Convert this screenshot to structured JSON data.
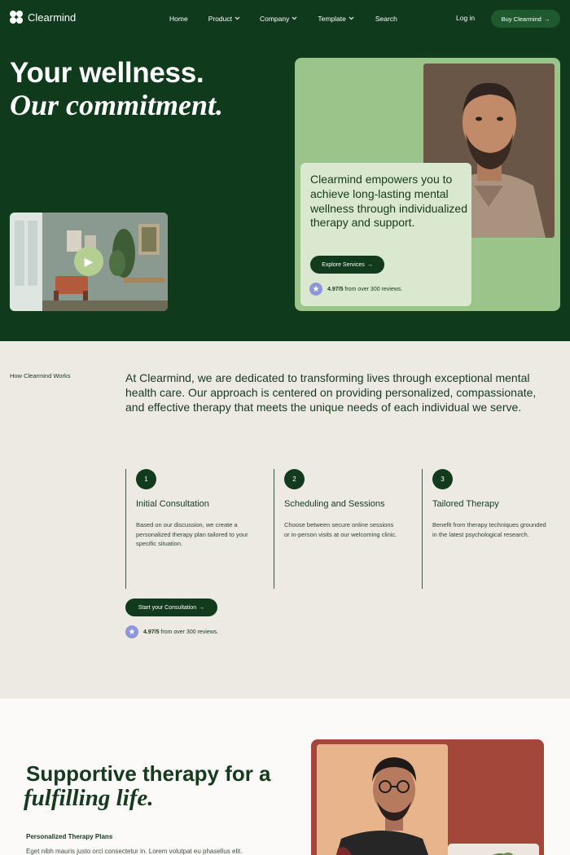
{
  "nav": {
    "brand": "Clearmind",
    "links": [
      {
        "label": "Home",
        "has_dropdown": false
      },
      {
        "label": "Product",
        "has_dropdown": true
      },
      {
        "label": "Company",
        "has_dropdown": true
      },
      {
        "label": "Template",
        "has_dropdown": true
      },
      {
        "label": "Search",
        "has_dropdown": false
      }
    ],
    "login": "Log in",
    "cta": "Buy Clearmind",
    "arrow": "→",
    "chevron": "⌄"
  },
  "hero": {
    "title_line1": "Your wellness.",
    "title_line2": "Our commitment.",
    "quote": "Clearmind empowers you to achieve long-lasting mental wellness through individualized therapy and support.",
    "cta": "Explore Services",
    "play_icon": "▶"
  },
  "rating": {
    "score": "4.97/5",
    "text": "from over 300 reviews.",
    "star": "★"
  },
  "how": {
    "label": "How Clearmind Works",
    "intro": "At Clearmind, we are dedicated to transforming lives through exceptional mental health care. Our approach is centered on providing personalized, compassionate, and effective therapy that meets the unique needs of each individual we serve.",
    "steps": [
      {
        "number": "1",
        "title": "Initial Consultation",
        "description": "Based on our discussion, we create a personalized therapy plan tailored to your specific situation."
      },
      {
        "number": "2",
        "title": "Scheduling and Sessions",
        "description": "Choose between secure online sessions or in-person visits at our welcoming clinic."
      },
      {
        "number": "3",
        "title": "Tailored Therapy",
        "description": "Benefit from therapy techniques grounded in the latest psychological research."
      }
    ],
    "cta": "Start your Consultation"
  },
  "support": {
    "title_line1": "Supportive therapy for a",
    "title_line2": "fulfilling life.",
    "subtitle": "Personalized Therapy Plans",
    "body": "Eget nibh mauris justo orci consectetur in. Lorem volutpat eu phasellus elit."
  },
  "colors": {
    "hero_bg": "#0f3a1c",
    "accent_green": "#9bc48a",
    "button_dark": "#123a1c",
    "star_badge": "#8d96d8",
    "section_beige": "#ede9e3",
    "card_red": "#a4473b"
  }
}
